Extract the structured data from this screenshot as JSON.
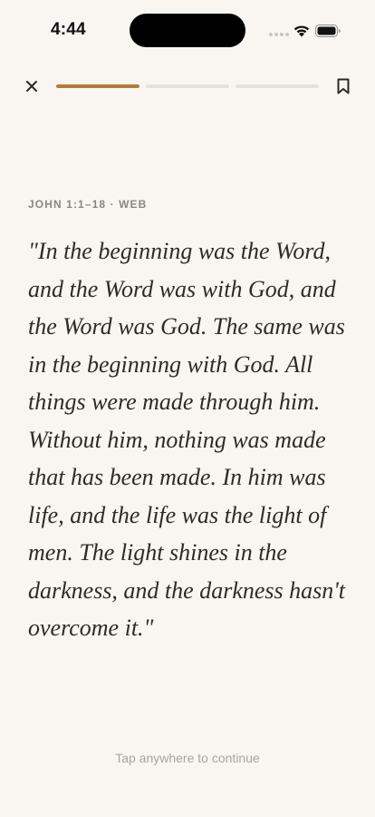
{
  "status_bar": {
    "time": "4:44",
    "icons": [
      "signal-icon",
      "wifi-icon",
      "battery-icon"
    ]
  },
  "controls": {
    "close_icon": "close-icon",
    "bookmark_icon": "bookmark-icon"
  },
  "progress": {
    "segments": 3,
    "current": 1,
    "fill_fraction": [
      1,
      0,
      0
    ],
    "accent_color": "#b5793a",
    "track_color": "#e6e1d9"
  },
  "reading": {
    "reference": "JOHN 1:1–18 · WEB",
    "verse_text": "\"In the beginning was the Word, and the Word was with God, and the Word was God. The same was in the beginning with God. All things were made through him. Without him, nothing was made that has been made. In him was life, and the life was the light of men. The light shines in the darkness, and the darkness hasn't overcome it.\""
  },
  "footer": {
    "hint": "Tap anywhere to continue"
  },
  "colors": {
    "background": "#f9f6f1",
    "text": "#2e2b28",
    "muted": "#8a8680"
  }
}
